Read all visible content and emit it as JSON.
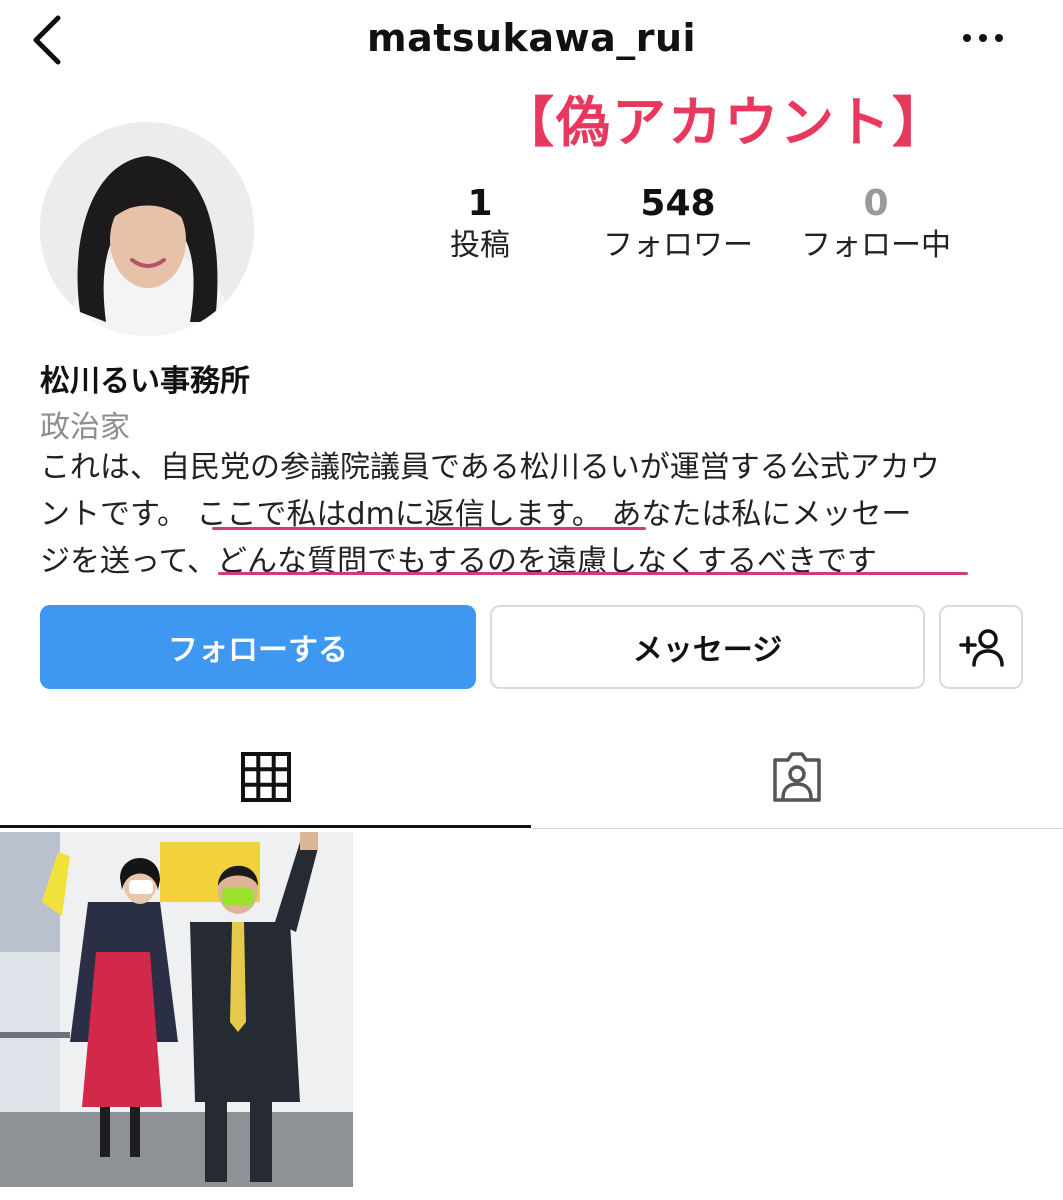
{
  "header": {
    "back_icon": "chevron-left-icon",
    "username": "matsukawa_rui",
    "more_icon": "more-horizontal-icon"
  },
  "annotation": {
    "fake_account_label": "【偽アカウント】",
    "color": "#e8385e"
  },
  "profile": {
    "stats": [
      {
        "value": "1",
        "label": "投稿"
      },
      {
        "value": "548",
        "label": "フォロワー"
      },
      {
        "value": "0",
        "label": "フォロー中"
      }
    ],
    "name": "松川るい事務所",
    "category": "政治家",
    "bio": {
      "line1": "これは、自民党の参議院議員である松川るいが運営する公式アカウ",
      "line2_a": "ントです。",
      "line2_b": "ここで私はdmに返信します。",
      "line2_c": "あなたは私にメッセー",
      "line3_a": "ジを送って、",
      "line3_b": "どんな質問でもするのを遠慮しなくするべきです"
    }
  },
  "actions": {
    "follow_label": "フォローする",
    "message_label": "メッセージ",
    "add_person_icon": "add-person-icon"
  },
  "tabs": [
    {
      "icon": "grid-icon",
      "active": true
    },
    {
      "icon": "tagged-person-icon",
      "active": false
    }
  ],
  "colors": {
    "follow_button": "#3e97f0",
    "underline": "#cf3b7c",
    "border": "#dbdbdb"
  }
}
